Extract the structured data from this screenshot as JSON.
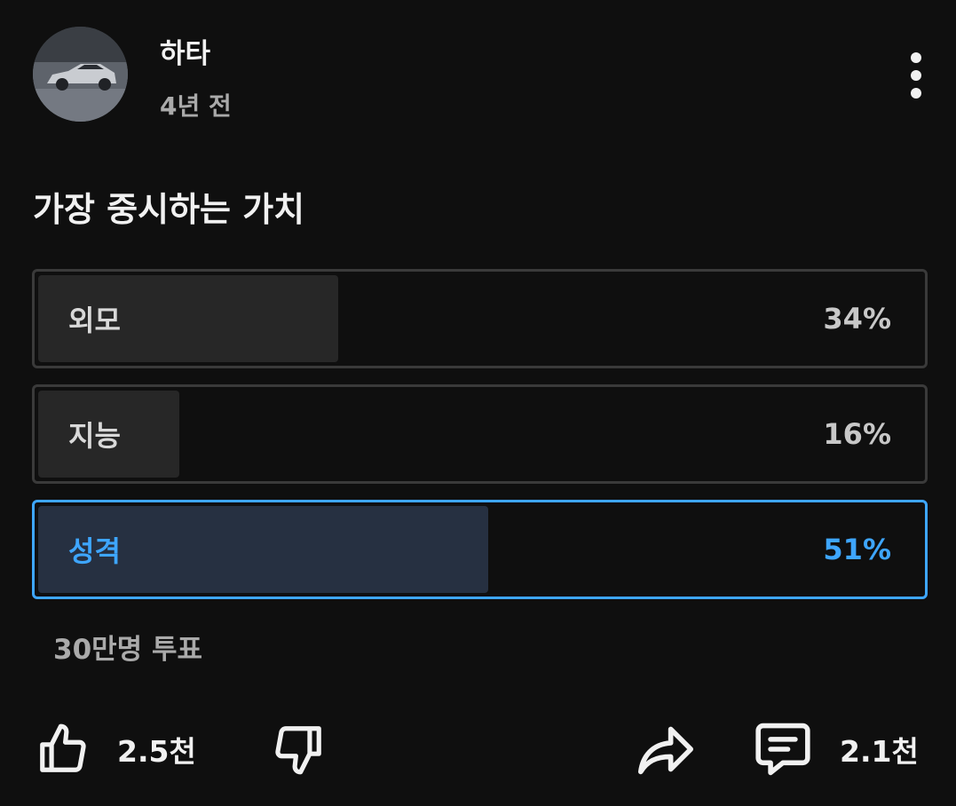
{
  "post": {
    "author": "하타",
    "time": "4년 전",
    "question": "가장 중시하는 가치"
  },
  "poll": {
    "options": [
      {
        "label": "외모",
        "percent_text": "34%",
        "percent": 34,
        "selected": false
      },
      {
        "label": "지능",
        "percent_text": "16%",
        "percent": 16,
        "selected": false
      },
      {
        "label": "성격",
        "percent_text": "51%",
        "percent": 51,
        "selected": true
      }
    ],
    "votes": "30만명 투표"
  },
  "actions": {
    "likes": "2.5천",
    "comments": "2.1천"
  },
  "icons": {
    "more": "more-vert-icon",
    "like": "thumbs-up-icon",
    "dislike": "thumbs-down-icon",
    "share": "share-icon",
    "comment": "comment-icon"
  },
  "colors": {
    "background": "#0f0f0f",
    "accent": "#3ea6ff",
    "bar": "#272727",
    "selected_bar": "#263041"
  }
}
